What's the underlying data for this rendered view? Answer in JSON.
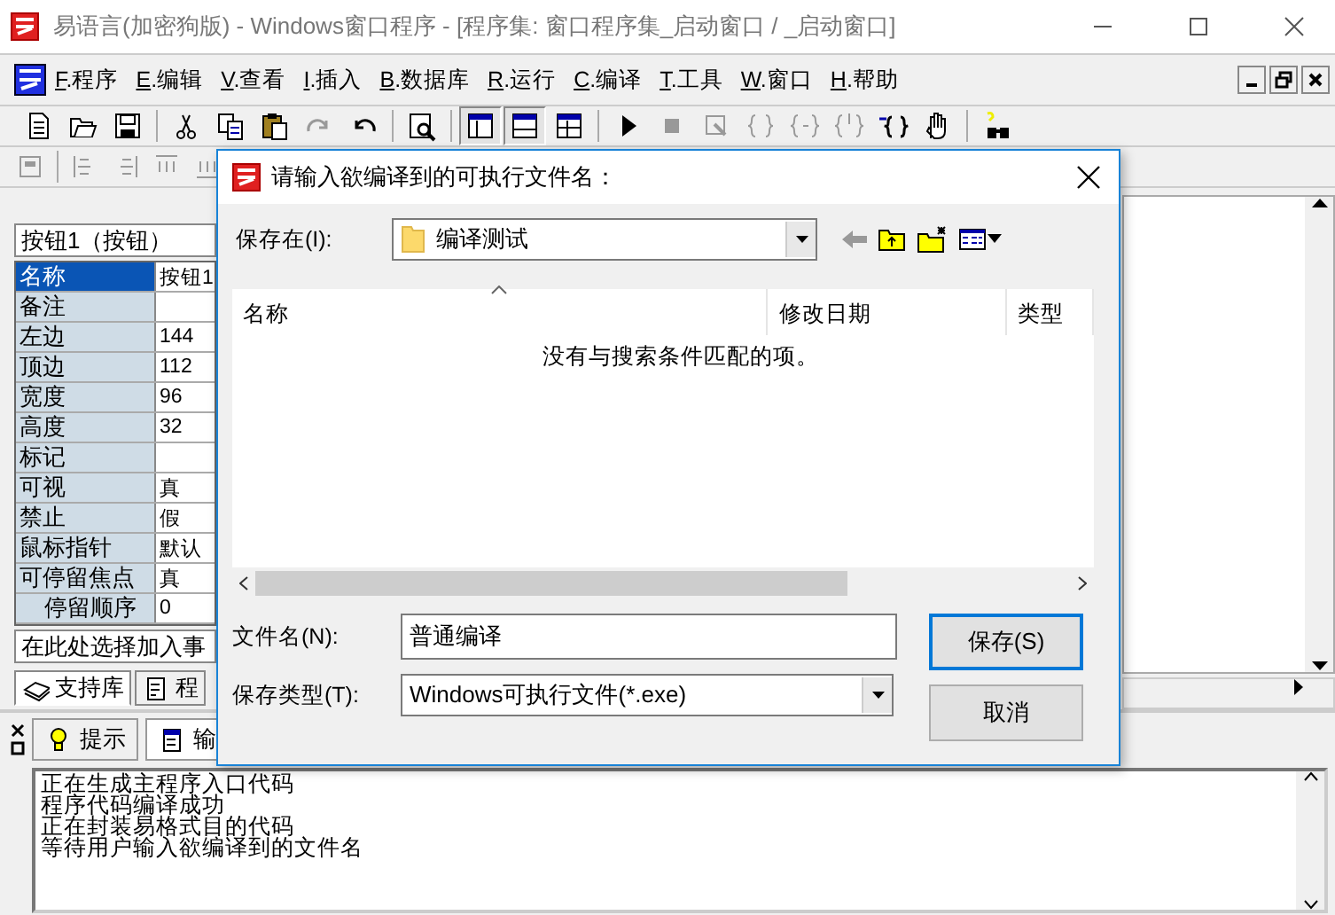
{
  "window": {
    "title": "易语言(加密狗版) - Windows窗口程序 - [程序集: 窗口程序集_启动窗口 / _启动窗口]"
  },
  "menu": [
    "F.程序",
    "E.编辑",
    "V.查看",
    "I.插入",
    "B.数据库",
    "R.运行",
    "C.编译",
    "T.工具",
    "W.窗口",
    "H.帮助"
  ],
  "toolbar": [
    {
      "disabled": false,
      "pressed": false
    },
    {
      "disabled": false,
      "pressed": false
    },
    {
      "disabled": false,
      "pressed": false
    },
    {
      "disabled": false,
      "pressed": false
    },
    {
      "disabled": false,
      "pressed": false
    },
    {
      "disabled": false,
      "pressed": false
    },
    {
      "disabled": true,
      "pressed": false
    },
    {
      "disabled": false,
      "pressed": false
    },
    {
      "disabled": false,
      "pressed": false
    },
    {
      "disabled": false,
      "pressed": true
    },
    {
      "disabled": false,
      "pressed": true
    },
    {
      "disabled": false,
      "pressed": false
    },
    {
      "disabled": false,
      "pressed": false
    },
    {
      "disabled": true,
      "pressed": false
    },
    {
      "disabled": true,
      "pressed": false
    },
    {
      "disabled": true,
      "pressed": false
    },
    {
      "disabled": true,
      "pressed": false
    },
    {
      "disabled": true,
      "pressed": false
    },
    {
      "disabled": false,
      "pressed": false
    },
    {
      "disabled": false,
      "pressed": false
    },
    {
      "disabled": false,
      "pressed": false
    }
  ],
  "toolbar2": [
    {
      "disabled": true
    },
    {
      "disabled": true
    },
    {
      "disabled": true
    },
    {
      "disabled": true
    },
    {
      "disabled": true
    }
  ],
  "properties": {
    "object": "按钮1（按钮）",
    "rows": [
      {
        "name": "名称",
        "value": "按钮1",
        "selected": true
      },
      {
        "name": "备注",
        "value": "",
        "selected": false
      },
      {
        "name": "左边",
        "value": "144",
        "selected": false
      },
      {
        "name": "顶边",
        "value": "112",
        "selected": false
      },
      {
        "name": "宽度",
        "value": "96",
        "selected": false
      },
      {
        "name": "高度",
        "value": "32",
        "selected": false
      },
      {
        "name": "标记",
        "value": "",
        "selected": false
      },
      {
        "name": "可视",
        "value": "真",
        "selected": false
      },
      {
        "name": "禁止",
        "value": "假",
        "selected": false
      },
      {
        "name": "鼠标指针",
        "value": "默认",
        "selected": false
      },
      {
        "name": "可停留焦点",
        "value": "真",
        "selected": false,
        "children": [
          {
            "name": "停留顺序",
            "value": "0",
            "selected": false
          }
        ]
      }
    ],
    "event": "在此处选择加入事"
  },
  "left_tabs": [
    {
      "label": "支持库",
      "selected": true
    },
    {
      "label": "程",
      "selected": false
    }
  ],
  "bottom_tabs": [
    {
      "label": "提示",
      "selected": false
    },
    {
      "label": "输",
      "selected": true
    }
  ],
  "output": [
    "正在生成主程序入口代码",
    "程序代码编译成功",
    "正在封装易格式目的代码",
    "等待用户输入欲编译到的文件名"
  ],
  "dialog": {
    "title": "请输入欲编译到的可执行文件名：",
    "save_in_label": "保存在(I):",
    "save_in": "编译测试",
    "columns": [
      "名称",
      "修改日期",
      "类型"
    ],
    "empty_message": "没有与搜索条件匹配的项。",
    "filename_label": "文件名(N):",
    "filename": "普通编译",
    "filetype_label": "保存类型(T):",
    "filetype": "Windows可执行文件(*.exe)",
    "buttons": [
      {
        "label": "保存(S)",
        "default": true
      },
      {
        "label": "取消",
        "default": false
      }
    ]
  }
}
